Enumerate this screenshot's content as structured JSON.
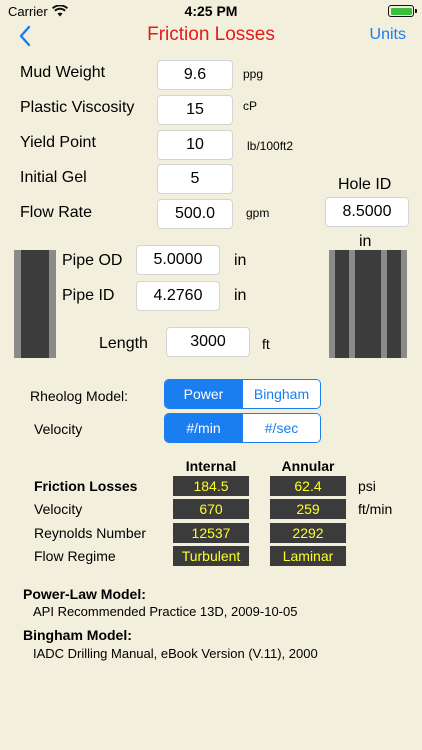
{
  "status_bar": {
    "carrier": "Carrier",
    "time": "4:25 PM"
  },
  "nav": {
    "title": "Friction Losses",
    "units_label": "Units"
  },
  "inputs": {
    "mud_weight": {
      "label": "Mud Weight",
      "value": "9.6",
      "unit": "ppg"
    },
    "plastic_viscosity": {
      "label": "Plastic Viscosity",
      "value": "15",
      "unit": "cP"
    },
    "yield_point": {
      "label": "Yield Point",
      "value": "10",
      "unit": "lb/100ft2"
    },
    "initial_gel": {
      "label": "Initial Gel",
      "value": "5"
    },
    "flow_rate": {
      "label": "Flow Rate",
      "value": "500.0",
      "unit": "gpm"
    },
    "hole_id": {
      "label": "Hole ID",
      "value": "8.5000",
      "unit": "in"
    },
    "pipe_od": {
      "label": "Pipe OD",
      "value": "5.0000",
      "unit": "in"
    },
    "pipe_id": {
      "label": "Pipe ID",
      "value": "4.2760",
      "unit": "in"
    },
    "length": {
      "label": "Length",
      "value": "3000",
      "unit": "ft"
    }
  },
  "rheology": {
    "label": "Rheolog Model:",
    "options": [
      "Power",
      "Bingham"
    ],
    "selected": "Power"
  },
  "velocity_unit": {
    "label": "Velocity",
    "options": [
      "#/min",
      "#/sec"
    ],
    "selected": "#/min"
  },
  "results": {
    "col_internal": "Internal",
    "col_annular": "Annular",
    "rows": [
      {
        "label": "Friction Losses",
        "internal": "184.5",
        "annular": "62.4",
        "unit": "psi"
      },
      {
        "label": "Velocity",
        "internal": "670",
        "annular": "259",
        "unit": "ft/min"
      },
      {
        "label": "Reynolds Number",
        "internal": "12537",
        "annular": "2292",
        "unit": ""
      },
      {
        "label": "Flow Regime",
        "internal": "Turbulent",
        "annular": "Laminar",
        "unit": ""
      }
    ]
  },
  "references": {
    "power_title": "Power-Law Model:",
    "power_body": "API Recommended Practice 13D, 2009-10-05",
    "bingham_title": "Bingham Model:",
    "bingham_body": "IADC Drilling Manual, eBook Version (V.11), 2000"
  },
  "colors": {
    "background": "#f2efdc",
    "title_red": "#e31b1b",
    "accent_blue": "#1a7df0",
    "result_bg": "#3b3b3b",
    "result_text": "#ffff24"
  }
}
